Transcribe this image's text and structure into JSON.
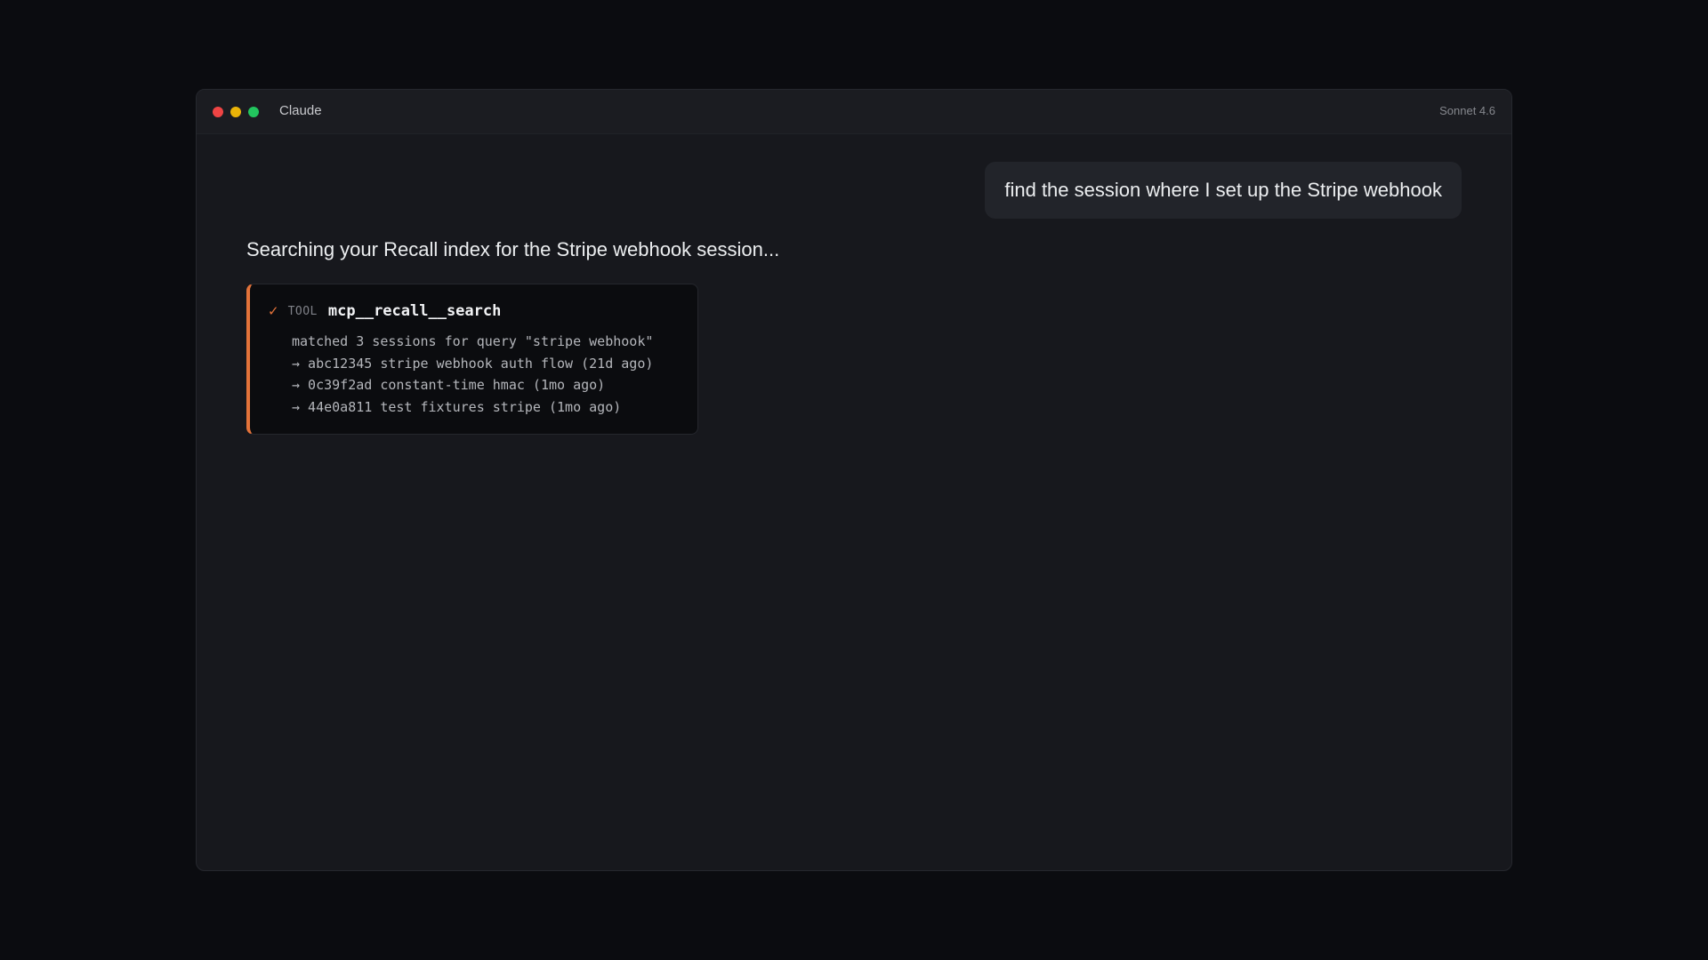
{
  "window": {
    "app_title": "Claude",
    "model_label": "Sonnet 4.6",
    "traffic_lights": {
      "close_color": "#ef4444",
      "minimize_color": "#eab308",
      "zoom_color": "#22c55e"
    }
  },
  "conversation": {
    "user_message": "find the session where I set up the Stripe webhook",
    "assistant_message": "Searching your Recall index for the Stripe webhook session...",
    "tool_call": {
      "status_icon": "check-icon",
      "status_glyph": "✓",
      "tag": "TOOL",
      "name": "mcp__recall__search",
      "accent_color": "#e4733a",
      "output_lines": [
        "matched 3 sessions for query \"stripe webhook\"",
        "→ abc12345 stripe webhook auth flow (21d ago)",
        "→ 0c39f2ad constant-time hmac (1mo ago)",
        "→ 44e0a811 test fixtures stripe (1mo ago)"
      ]
    }
  }
}
